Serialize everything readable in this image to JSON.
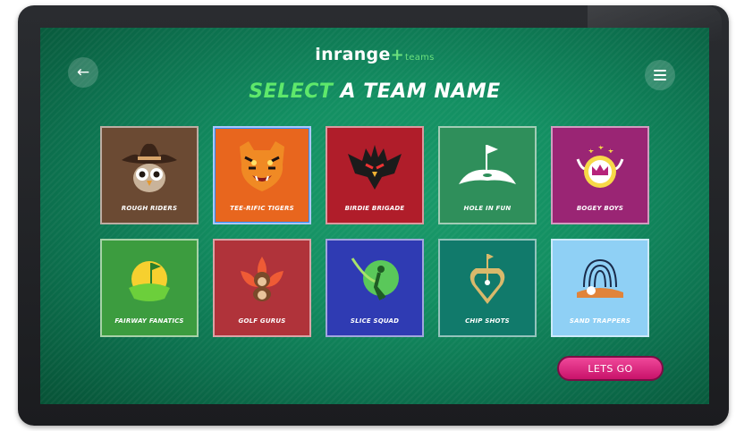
{
  "header": {
    "logo_text": "inrange",
    "logo_plus": "+",
    "logo_sub": "teams",
    "back_icon": "arrow-left-icon",
    "menu_icon": "hamburger-menu-icon"
  },
  "title": {
    "accent": "SELECT",
    "rest": " A TEAM NAME"
  },
  "teams": [
    {
      "name": "ROUGH RIDERS",
      "bg": "#6b4a33",
      "icon": "cowboy-owl-icon"
    },
    {
      "name": "TEE-RIFIC TIGERS",
      "bg": "#e8661e",
      "icon": "tiger-icon",
      "selected": true
    },
    {
      "name": "BIRDIE BRIGADE",
      "bg": "#b01d2a",
      "icon": "eagle-icon"
    },
    {
      "name": "HOLE IN FUN",
      "bg": "#2f8f5b",
      "icon": "golf-hole-flag-icon"
    },
    {
      "name": "BOGEY BOYS",
      "bg": "#9a2574",
      "icon": "crown-ball-icon"
    },
    {
      "name": "FAIRWAY FANATICS",
      "bg": "#3c9c3f",
      "icon": "flag-green-icon"
    },
    {
      "name": "GOLF GURUS",
      "bg": "#b0333a",
      "icon": "monkey-lotus-icon"
    },
    {
      "name": "SLICE SQUAD",
      "bg": "#2f3bb3",
      "icon": "golfer-swing-icon"
    },
    {
      "name": "CHIP SHOTS",
      "bg": "#117a6b",
      "icon": "pin-marker-icon"
    },
    {
      "name": "SAND TRAPPERS",
      "bg": "#8fd0f5",
      "icon": "fingerprint-ball-icon"
    }
  ],
  "actions": {
    "lets_go": "LETS GO"
  }
}
